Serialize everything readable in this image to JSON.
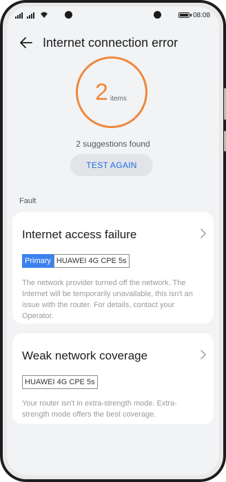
{
  "status_bar": {
    "time": "08:08"
  },
  "header": {
    "title": "Internet connection error"
  },
  "summary": {
    "count": "2",
    "unit": "items",
    "suggestions": "2 suggestions found",
    "test_again_label": "TEST AGAIN"
  },
  "section": {
    "label": "Fault"
  },
  "faults": [
    {
      "title": "Internet access failure",
      "primary_tag": "Primary",
      "device_tag": "HUAWEI 4G CPE 5s",
      "description": "The network provider turned off the network. The Internet will be temporarily unavailable, this isn't an issue with the router. For details, contact your Operator."
    },
    {
      "title": "Weak network coverage",
      "device_tag": "HUAWEI 4G CPE 5s",
      "description": "Your router isn't in extra-strength mode. Extra-strength mode offers the best coverage."
    }
  ],
  "colors": {
    "accent_orange": "#f0873a",
    "link_blue": "#1f6ae6",
    "primary_tag_blue": "#3c82ef"
  }
}
